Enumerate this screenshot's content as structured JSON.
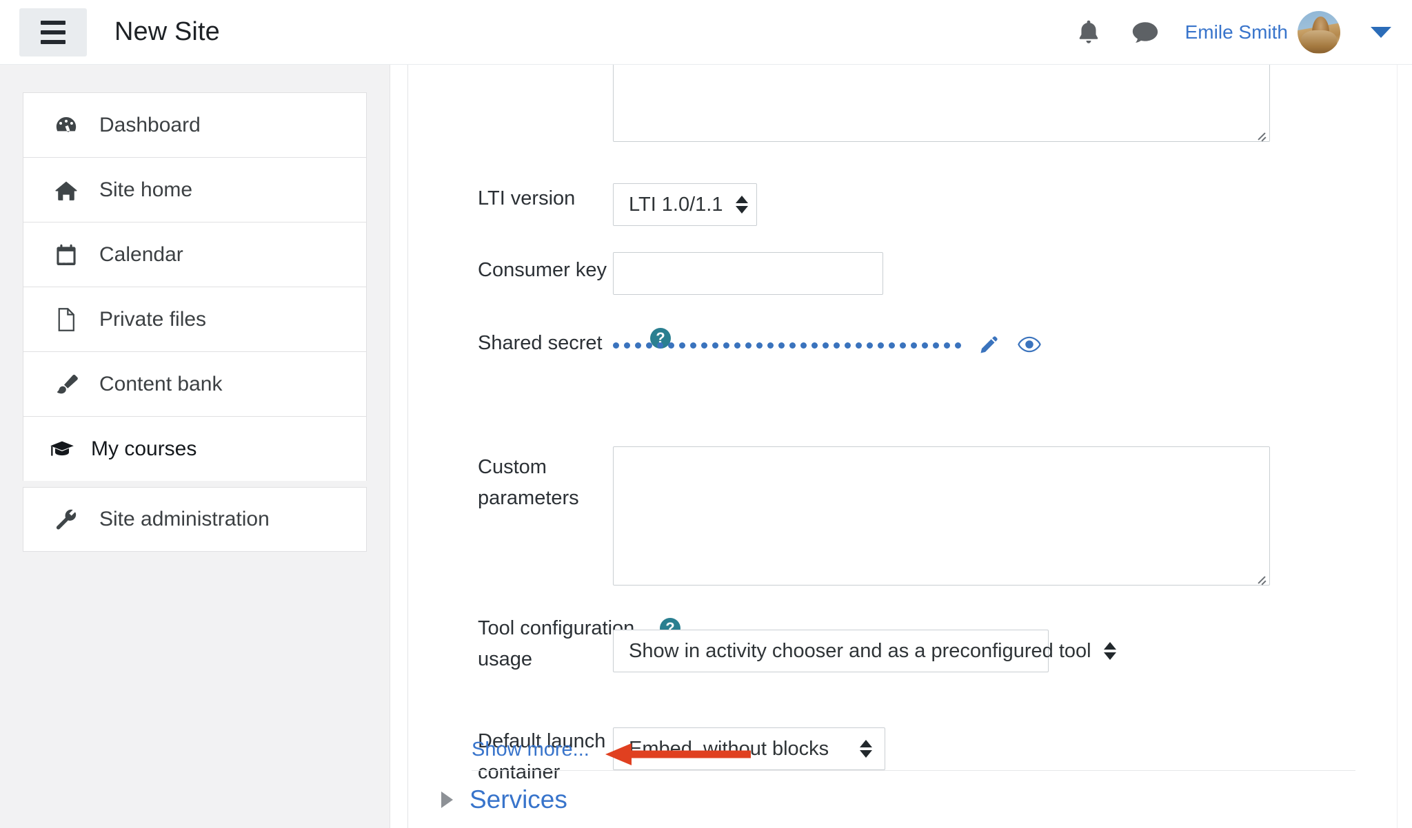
{
  "header": {
    "menu_button": "menu-toggle",
    "site_title": "New Site",
    "notifications_icon": "bell-icon",
    "messages_icon": "chat-bubble-icon",
    "user_name": "Emile Smith",
    "avatar_alt": "user-avatar",
    "caret_icon": "chevron-down-icon",
    "link_color": "#3874cb"
  },
  "sidebar": {
    "items": [
      {
        "label": "Dashboard",
        "icon": "dashboard-icon",
        "active": false
      },
      {
        "label": "Site home",
        "icon": "home-icon",
        "active": false
      },
      {
        "label": "Calendar",
        "icon": "calendar-icon",
        "active": false
      },
      {
        "label": "Private files",
        "icon": "file-icon",
        "active": false
      },
      {
        "label": "Content bank",
        "icon": "paintbrush-icon",
        "active": false
      },
      {
        "label": "My courses",
        "icon": "graduation-cap-icon",
        "active": true
      },
      {
        "label": "Site administration",
        "icon": "wrench-icon",
        "active": false
      }
    ]
  },
  "form": {
    "help_icon": "question-mark-help-icon",
    "top_textarea": {
      "name": "tool-description-textarea",
      "value": ""
    },
    "fields": [
      {
        "label": "LTI version",
        "control": "select",
        "value": "LTI 1.0/1.1"
      },
      {
        "label": "Consumer key",
        "control": "text",
        "value": "",
        "placeholder": ""
      },
      {
        "label": "Shared secret",
        "control": "masked",
        "masked_dots": 32,
        "edit_icon": "pencil-icon",
        "reveal_icon": "eye-icon"
      },
      {
        "label": "Custom parameters",
        "control": "textarea",
        "value": ""
      },
      {
        "label": "Tool configuration usage",
        "control": "select",
        "value": "Show in activity chooser and as a preconfigured tool"
      },
      {
        "label": "Default launch container",
        "control": "select",
        "value": "Embed, without blocks"
      }
    ],
    "show_more": "Show more..."
  },
  "sections": {
    "services": {
      "title": "Services",
      "expanded": false,
      "toggle_icon": "triangle-right-icon"
    }
  },
  "annotation": {
    "arrow": "red-arrow-pointing-to-show-more",
    "color": "#e04020"
  },
  "colors": {
    "help_teal": "#2a7f90",
    "link_blue": "#3874cb",
    "text_dark": "#2b3035",
    "sidebar_bg": "#f2f2f3",
    "border": "#c9ced2"
  }
}
